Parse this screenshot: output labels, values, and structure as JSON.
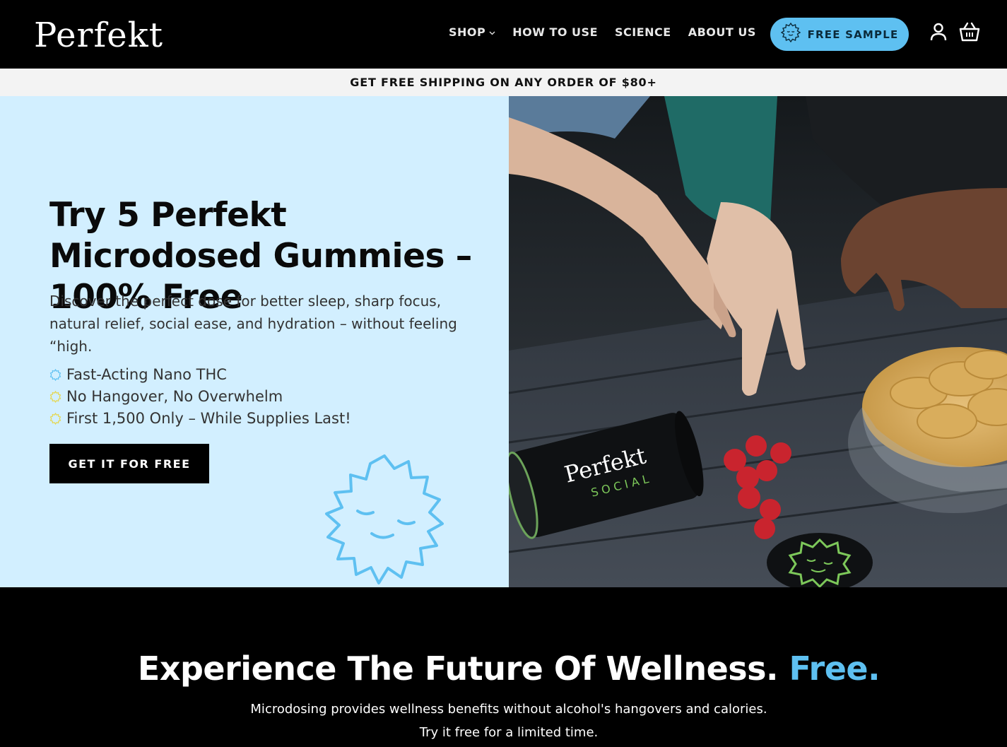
{
  "header": {
    "logo": "Perfekt",
    "nav": [
      {
        "label": "SHOP",
        "has_dropdown": true
      },
      {
        "label": "HOW TO USE"
      },
      {
        "label": "SCIENCE"
      },
      {
        "label": "ABOUT US"
      }
    ],
    "sample_button": "FREE SAMPLE",
    "icons": [
      "account-icon",
      "cart-icon"
    ]
  },
  "announcement": "GET FREE SHIPPING ON ANY ORDER OF $80+",
  "hero": {
    "title": "Try 5 Perfekt Microdosed Gummies – 100% Free",
    "description": "Discover the perfect dose for better sleep, sharp focus, natural relief, social ease, and hydration – without feeling “high.",
    "bullets": [
      {
        "text": "Fast-Acting Nano THC",
        "color": "#5ec0f1"
      },
      {
        "text": "No Hangover, No Overwhelm",
        "color": "#e6d64a"
      },
      {
        "text": "First 1,500 Only – While Supplies Last!",
        "color": "#e6d64a"
      }
    ],
    "cta": "GET IT FOR FREE",
    "product": {
      "brand": "Perfekt",
      "line": "SOCIAL"
    }
  },
  "section": {
    "title": "Experience The Future Of Wellness.",
    "title_accent": "Free.",
    "subtitle": "Microdosing provides wellness benefits without alcohol's hangovers and calories. Try it free for a limited time."
  },
  "colors": {
    "accent": "#5ec0f1",
    "hero_bg": "#d2efff",
    "header_bg": "#000000",
    "bullet_yellow": "#e6d64a"
  }
}
